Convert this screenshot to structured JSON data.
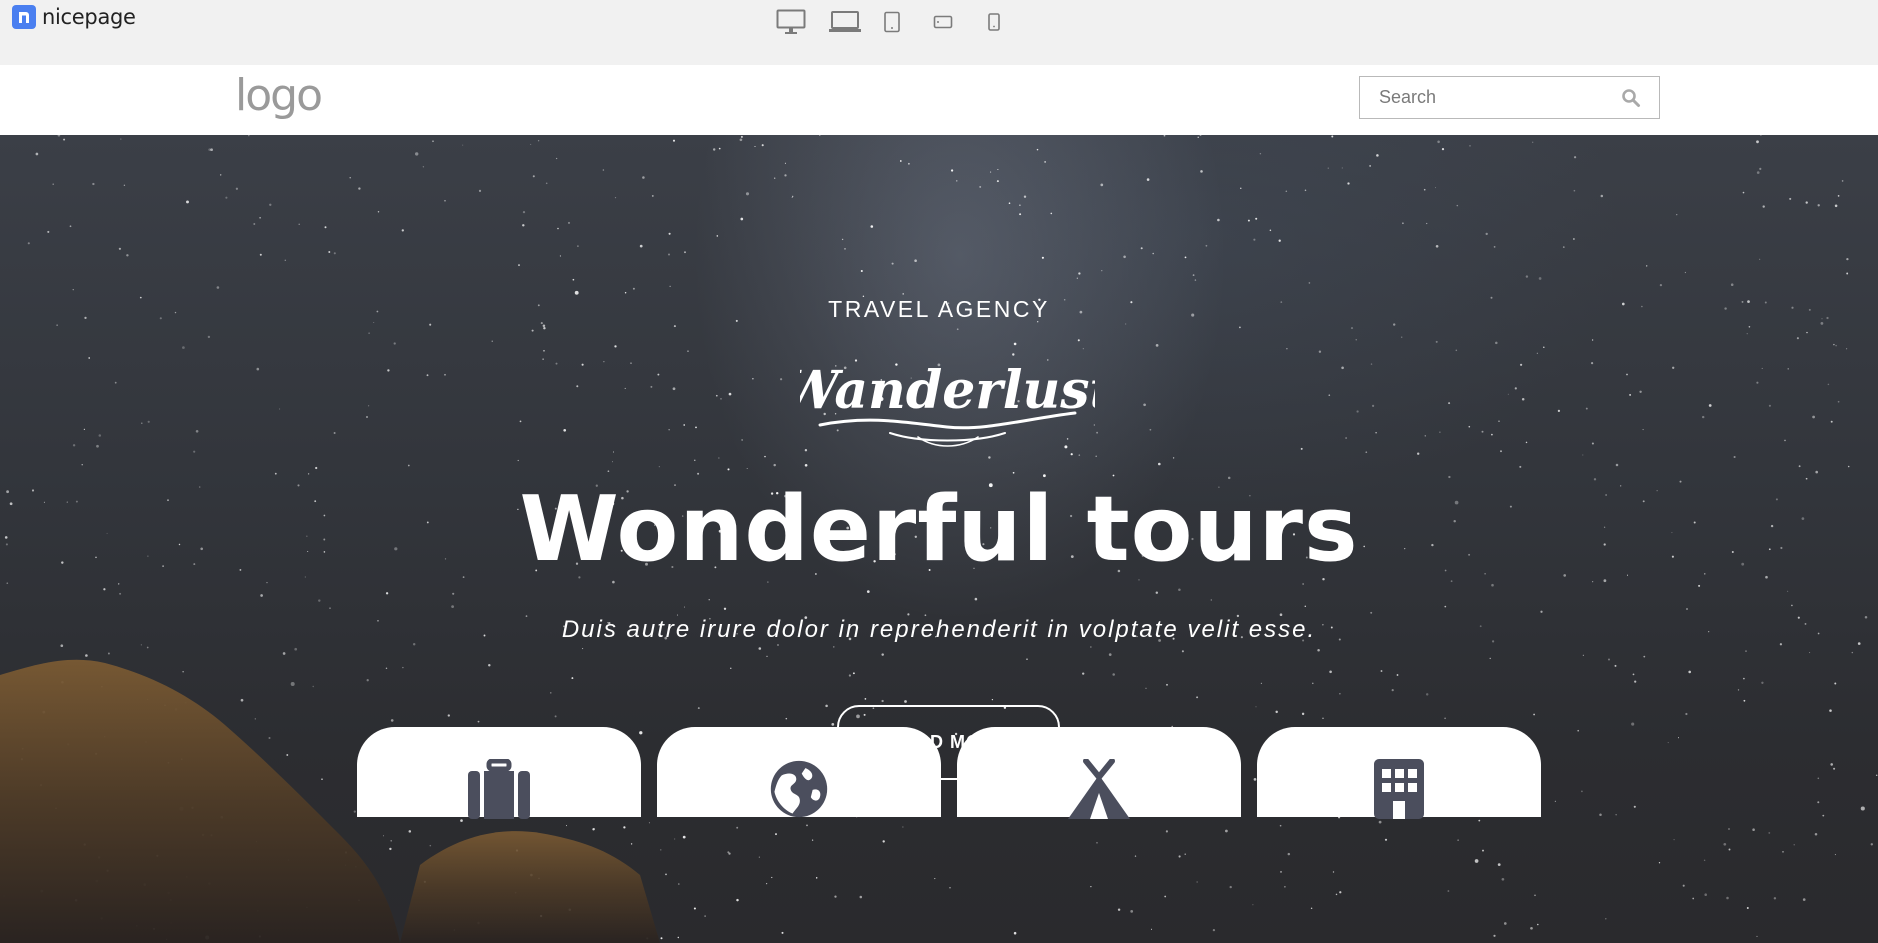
{
  "app": {
    "name": "nicepage"
  },
  "toolbar": {
    "devices": [
      {
        "icon": "desktop-icon"
      },
      {
        "icon": "laptop-icon"
      },
      {
        "icon": "tablet-icon"
      },
      {
        "icon": "tablet-landscape-icon"
      },
      {
        "icon": "phone-icon"
      }
    ]
  },
  "header": {
    "logo_text": "logo",
    "search": {
      "placeholder": "Search",
      "value": "",
      "icon": "search-icon"
    }
  },
  "hero": {
    "kicker": "TRAVEL AGENCY",
    "script_logo": "Wanderlust",
    "headline": "Wonderful tours",
    "subline": "Duis autre irure dolor in reprehenderit in volptate velit esse.",
    "cta_label": "READ MORE"
  },
  "feature_cards": [
    {
      "icon": "suitcase-icon"
    },
    {
      "icon": "globe-icon"
    },
    {
      "icon": "tent-icon"
    },
    {
      "icon": "hotel-icon"
    }
  ],
  "colors": {
    "brand": "#4a7ff0",
    "icon_dark": "#4b4e5d",
    "hero_bg": "#33363c",
    "logo_gray": "#9a9a9a"
  }
}
